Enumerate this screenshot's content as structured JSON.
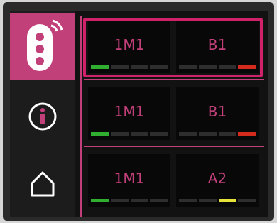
{
  "sidebar": {
    "items": [
      {
        "icon": "traffic-light-remote-icon",
        "active": true
      },
      {
        "icon": "info-icon",
        "active": false
      },
      {
        "icon": "home-icon",
        "active": false
      }
    ]
  },
  "tiles": [
    {
      "label": "1M1",
      "bars": [
        "green",
        "off",
        "off",
        "off"
      ]
    },
    {
      "label": "B1",
      "bars": [
        "off",
        "off",
        "off",
        "red"
      ]
    },
    {
      "label": "1M1",
      "bars": [
        "green",
        "off",
        "off",
        "off"
      ]
    },
    {
      "label": "B1",
      "bars": [
        "off",
        "off",
        "off",
        "red"
      ]
    },
    {
      "label": "1M1",
      "bars": [
        "green",
        "off",
        "off",
        "off"
      ]
    },
    {
      "label": "A2",
      "bars": [
        "off",
        "off",
        "yellow",
        "off"
      ]
    }
  ],
  "colors": {
    "accent": "#c2407a",
    "highlight": "#d0216b",
    "green": "#2fae2f",
    "red": "#d42b1c",
    "yellow": "#e6e23a",
    "off": "#2e2e2e"
  }
}
